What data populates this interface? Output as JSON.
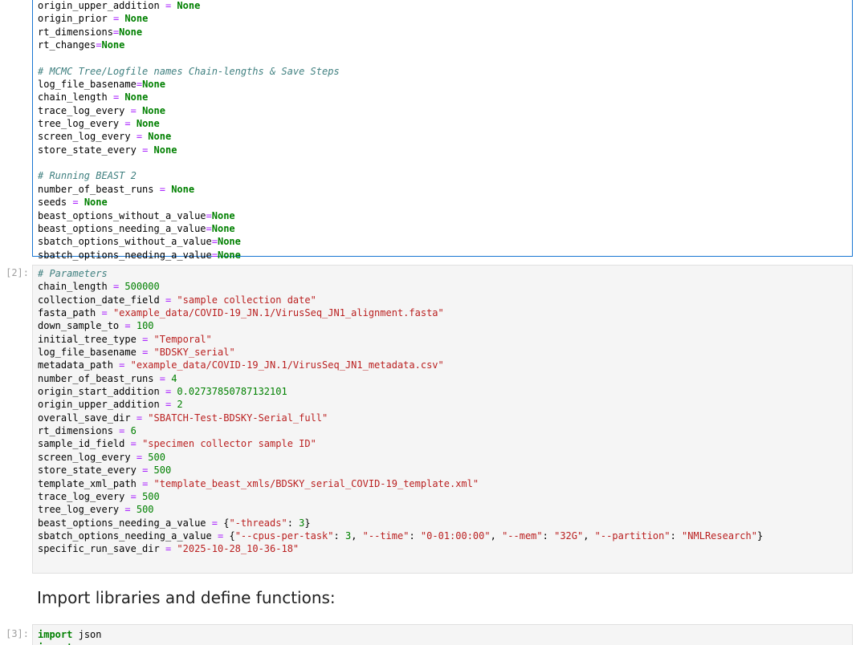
{
  "cell1": {
    "lines": [
      {
        "name": "origin_upper_addition",
        "op": "=",
        "spaced": true,
        "value": "None"
      },
      {
        "name": "origin_prior",
        "op": "=",
        "spaced": true,
        "value": "None"
      },
      {
        "name": "rt_dimensions",
        "op": "=",
        "spaced": false,
        "value": "None"
      },
      {
        "name": "rt_changes",
        "op": "=",
        "spaced": false,
        "value": "None"
      },
      {
        "blank": true
      },
      {
        "comment": "# MCMC Tree/Logfile names Chain-lengths & Save Steps"
      },
      {
        "name": "log_file_basename",
        "op": "=",
        "spaced": false,
        "value": "None"
      },
      {
        "name": "chain_length",
        "op": "=",
        "spaced": true,
        "value": "None"
      },
      {
        "name": "trace_log_every",
        "op": "=",
        "spaced": true,
        "value": "None"
      },
      {
        "name": "tree_log_every",
        "op": "=",
        "spaced": true,
        "value": "None"
      },
      {
        "name": "screen_log_every",
        "op": "=",
        "spaced": true,
        "value": "None"
      },
      {
        "name": "store_state_every",
        "op": "=",
        "spaced": true,
        "value": "None"
      },
      {
        "blank": true
      },
      {
        "comment": "# Running BEAST 2"
      },
      {
        "name": "number_of_beast_runs",
        "op": "=",
        "spaced": true,
        "value": "None"
      },
      {
        "name": "seeds",
        "op": "=",
        "spaced": true,
        "value": "None"
      },
      {
        "name": "beast_options_without_a_value",
        "op": "=",
        "spaced": false,
        "value": "None"
      },
      {
        "name": "beast_options_needing_a_value",
        "op": "=",
        "spaced": false,
        "value": "None"
      },
      {
        "name": "sbatch_options_without_a_value",
        "op": "=",
        "spaced": false,
        "value": "None"
      },
      {
        "name": "sbatch_options_needing_a_value",
        "op": "=",
        "spaced": false,
        "value": "None"
      }
    ]
  },
  "cell2": {
    "prompt": "[2]:",
    "comment": "# Parameters",
    "lines": [
      {
        "name": "chain_length",
        "kind": "num",
        "value": "500000"
      },
      {
        "name": "collection_date_field",
        "kind": "str",
        "value": "\"sample collection date\""
      },
      {
        "name": "fasta_path",
        "kind": "str",
        "value": "\"example_data/COVID-19_JN.1/VirusSeq_JN1_alignment.fasta\""
      },
      {
        "name": "down_sample_to",
        "kind": "num",
        "value": "100"
      },
      {
        "name": "initial_tree_type",
        "kind": "str",
        "value": "\"Temporal\""
      },
      {
        "name": "log_file_basename",
        "kind": "str",
        "value": "\"BDSKY_serial\""
      },
      {
        "name": "metadata_path",
        "kind": "str",
        "value": "\"example_data/COVID-19_JN.1/VirusSeq_JN1_metadata.csv\""
      },
      {
        "name": "number_of_beast_runs",
        "kind": "num",
        "value": "4"
      },
      {
        "name": "origin_start_addition",
        "kind": "num",
        "value": "0.02737850787132101"
      },
      {
        "name": "origin_upper_addition",
        "kind": "num",
        "value": "2"
      },
      {
        "name": "overall_save_dir",
        "kind": "str",
        "value": "\"SBATCH-Test-BDSKY-Serial_full\""
      },
      {
        "name": "rt_dimensions",
        "kind": "num",
        "value": "6"
      },
      {
        "name": "sample_id_field",
        "kind": "str",
        "value": "\"specimen collector sample ID\""
      },
      {
        "name": "screen_log_every",
        "kind": "num",
        "value": "500"
      },
      {
        "name": "store_state_every",
        "kind": "num",
        "value": "500"
      },
      {
        "name": "template_xml_path",
        "kind": "str",
        "value": "\"template_beast_xmls/BDSKY_serial_COVID-19_template.xml\""
      },
      {
        "name": "trace_log_every",
        "kind": "num",
        "value": "500"
      },
      {
        "name": "tree_log_every",
        "kind": "num",
        "value": "500"
      }
    ],
    "beast_options": {
      "name": "beast_options_needing_a_value",
      "key": "\"-threads\"",
      "value": "3"
    },
    "sbatch_options": {
      "name": "sbatch_options_needing_a_value",
      "pairs": [
        {
          "key": "\"--cpus-per-task\"",
          "value": "3",
          "kind": "num"
        },
        {
          "key": "\"--time\"",
          "value": "\"0-01:00:00\"",
          "kind": "str"
        },
        {
          "key": "\"--mem\"",
          "value": "\"32G\"",
          "kind": "str"
        },
        {
          "key": "\"--partition\"",
          "value": "\"NMLResearch\"",
          "kind": "str"
        }
      ]
    },
    "run_dir": {
      "name": "specific_run_save_dir",
      "value": "\"2025-10-28_10-36-18\""
    }
  },
  "heading": "Import libraries and define functions:",
  "cell3": {
    "prompt": "[3]:",
    "keyword": "import",
    "module": "json",
    "next_keyword": "import"
  },
  "colors": {
    "active_cell_border": "#1976d2",
    "code_bg": "#f5f5f5",
    "keyword": "#008000",
    "string": "#ba2121",
    "comment": "#408080",
    "operator": "#aa22ff"
  }
}
